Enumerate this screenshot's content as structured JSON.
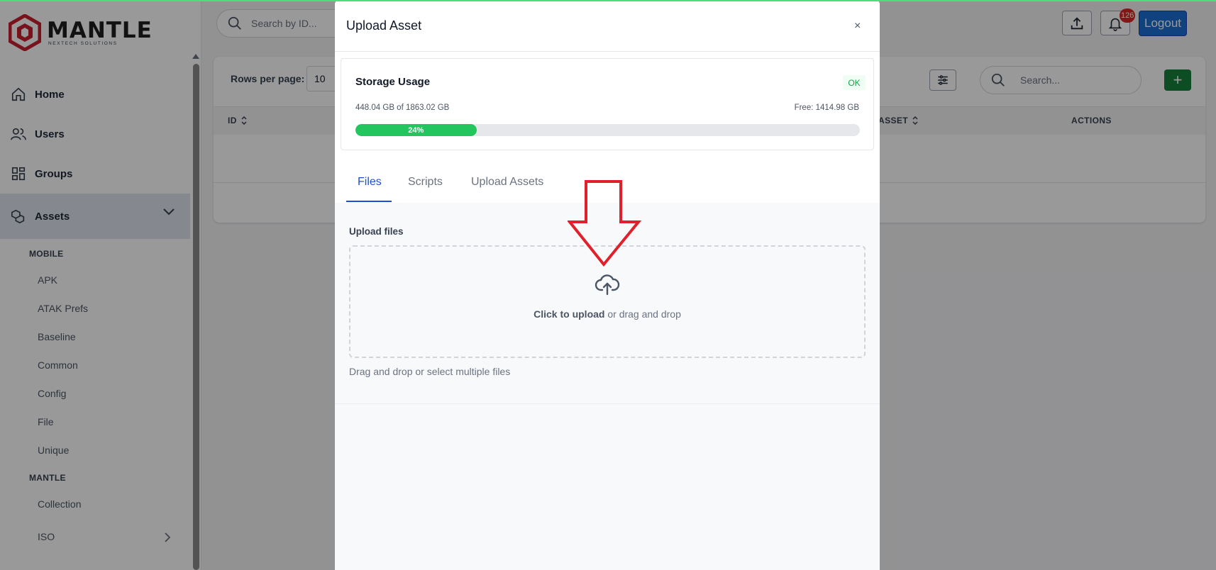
{
  "brand": {
    "name": "MANTLE",
    "tagline": "NEXTECH SOLUTIONS",
    "accent": "#c8202f"
  },
  "topbar": {
    "search_placeholder": "Search by ID...",
    "notification_count": "126",
    "logout_label": "Logout"
  },
  "sidebar": {
    "items": [
      {
        "label": "Home",
        "icon": "home-icon"
      },
      {
        "label": "Users",
        "icon": "users-icon"
      },
      {
        "label": "Groups",
        "icon": "grid-icon"
      },
      {
        "label": "Assets",
        "icon": "assets-icon",
        "active": true
      }
    ],
    "sections": [
      {
        "label": "MOBILE",
        "items": [
          "APK",
          "ATAK Prefs",
          "Baseline",
          "Common",
          "Config",
          "File",
          "Unique"
        ]
      },
      {
        "label": "MANTLE",
        "items": [
          "Collection",
          "ISO"
        ]
      }
    ]
  },
  "main": {
    "rows_per_page_label": "Rows per page:",
    "rows_per_page_value": "10",
    "search_placeholder": "Search...",
    "add_label": "+",
    "columns": [
      "ID",
      "ASSET",
      "ACTIONS"
    ]
  },
  "modal": {
    "title": "Upload Asset",
    "close_label": "×",
    "storage": {
      "title": "Storage Usage",
      "status": "OK",
      "used_text": "448.04 GB of 1863.02 GB",
      "free_text": "Free: 1414.98 GB",
      "percent": 24,
      "percent_label": "24%"
    },
    "tabs": [
      "Files",
      "Scripts",
      "Upload Assets"
    ],
    "active_tab": "Files",
    "upload": {
      "label": "Upload files",
      "click_text": "Click to upload",
      "drag_text": " or drag and drop",
      "hint": "Drag and drop or select multiple files"
    }
  },
  "colors": {
    "primary": "#1d6fd6",
    "success": "#22c55e",
    "add_button": "#15803d",
    "badge": "#dc2626",
    "annotation": "#e0202a"
  }
}
